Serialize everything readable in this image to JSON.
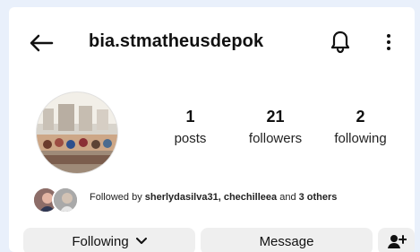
{
  "header": {
    "username": "bia.stmatheusdepok",
    "icons": {
      "back": "arrow-left-icon",
      "bell": "bell-icon",
      "more": "more-vertical-icon"
    }
  },
  "profile": {
    "stats": [
      {
        "value": "1",
        "label": "posts"
      },
      {
        "value": "21",
        "label": "followers"
      },
      {
        "value": "2",
        "label": "following"
      }
    ],
    "followed_by": {
      "prefix": "Followed by",
      "names": "sherlydasilva31, chechilleea",
      "middle": "and",
      "others": "3 others"
    }
  },
  "actions": {
    "following_label": "Following",
    "message_label": "Message",
    "add_user_icon": "person-plus-icon"
  },
  "colors": {
    "background": "#e9f0fb",
    "panel": "#ffffff",
    "button": "#efefef",
    "text": "#111111"
  }
}
